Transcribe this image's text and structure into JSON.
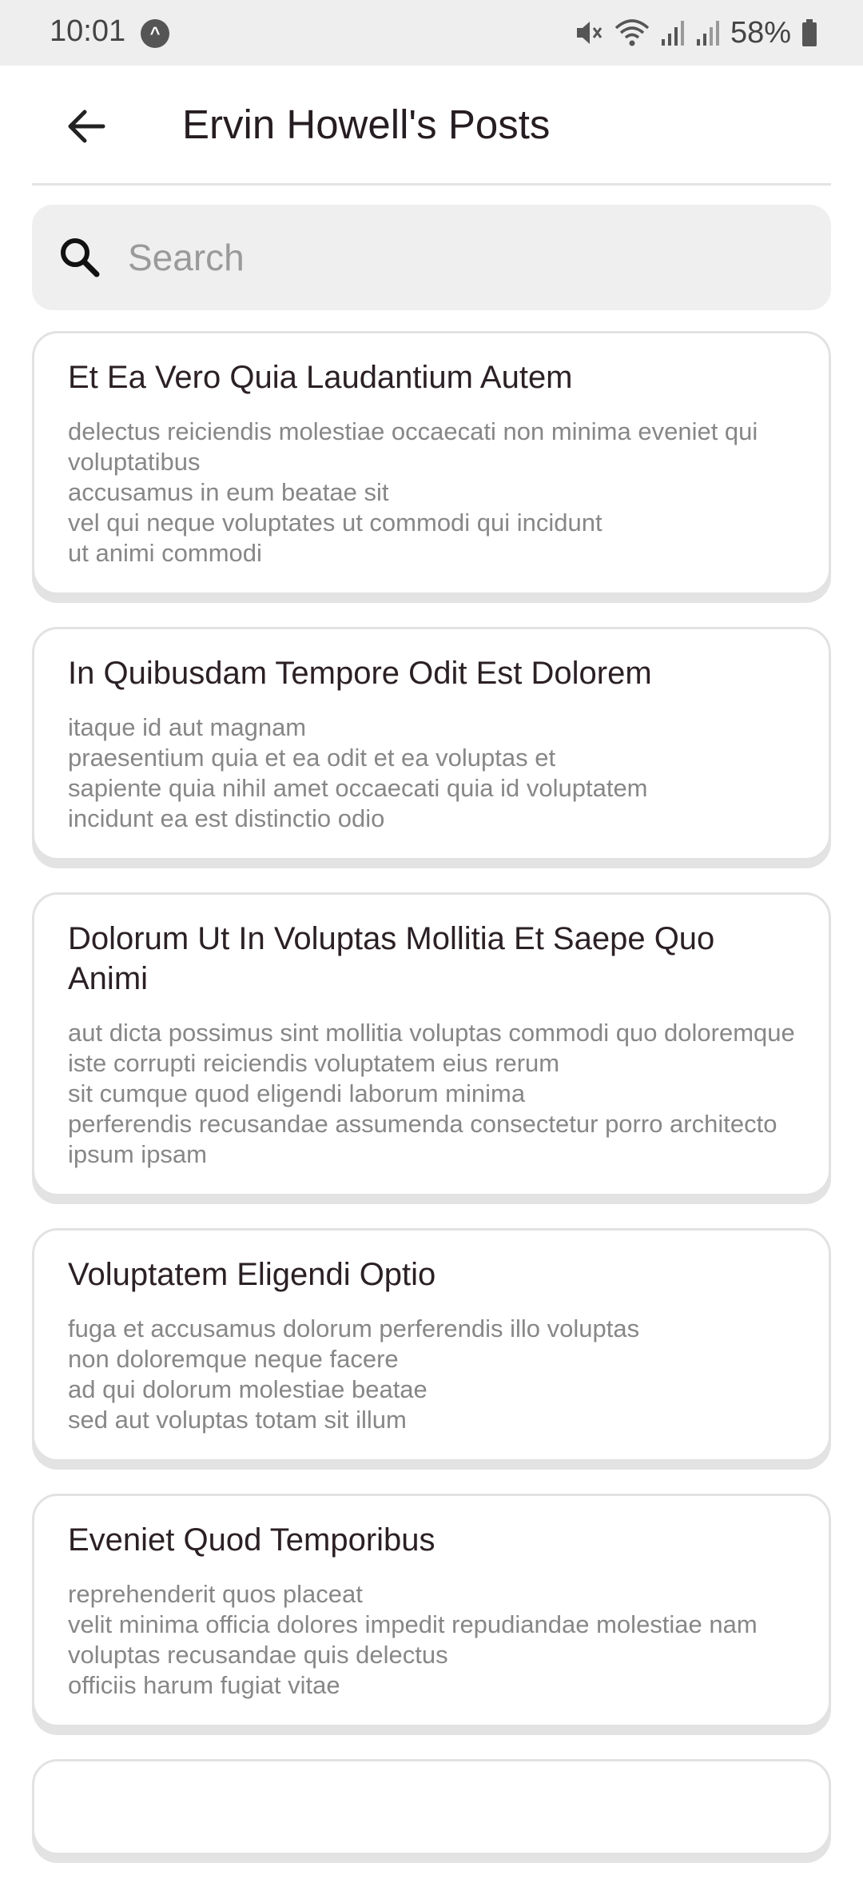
{
  "status_bar": {
    "time": "10:01",
    "battery_percent": "58%"
  },
  "header": {
    "title": "Ervin Howell's Posts",
    "back_icon": "arrow-left-icon"
  },
  "search": {
    "placeholder": "Search",
    "value": "",
    "icon": "search-icon"
  },
  "posts": [
    {
      "title": "Et Ea Vero Quia Laudantium Autem",
      "body": "delectus reiciendis molestiae occaecati non minima eveniet qui voluptatibus\naccusamus in eum beatae sit\nvel qui neque voluptates ut commodi qui incidunt\nut animi commodi"
    },
    {
      "title": "In Quibusdam Tempore Odit Est Dolorem",
      "body": "itaque id aut magnam\npraesentium quia et ea odit et ea voluptas et\nsapiente quia nihil amet occaecati quia id voluptatem\nincidunt ea est distinctio odio"
    },
    {
      "title": "Dolorum Ut In Voluptas Mollitia Et Saepe Quo Animi",
      "body": "aut dicta possimus sint mollitia voluptas commodi quo doloremque\niste corrupti reiciendis voluptatem eius rerum\nsit cumque quod eligendi laborum minima\nperferendis recusandae assumenda consectetur porro architecto ipsum ipsam"
    },
    {
      "title": "Voluptatem Eligendi Optio",
      "body": "fuga et accusamus dolorum perferendis illo voluptas\nnon doloremque neque facere\nad qui dolorum molestiae beatae\nsed aut voluptas totam sit illum"
    },
    {
      "title": "Eveniet Quod Temporibus",
      "body": "reprehenderit quos placeat\nvelit minima officia dolores impedit repudiandae molestiae nam\nvoluptas recusandae quis delectus\nofficiis harum fugiat vitae"
    }
  ],
  "colors": {
    "title_text": "#261d22",
    "body_text": "#878787",
    "search_bg": "#efefef",
    "card_border": "#e2e2e2"
  }
}
